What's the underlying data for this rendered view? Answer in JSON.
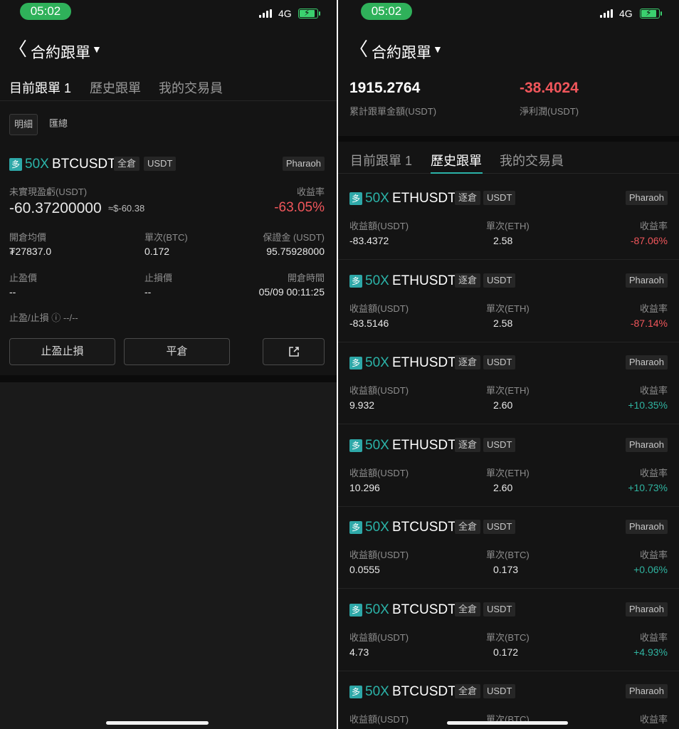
{
  "status": {
    "time": "05:02",
    "network": "4G"
  },
  "header": {
    "title": "合約跟單",
    "back": "〈",
    "caret": "▼"
  },
  "tabs": [
    "目前跟單 1",
    "歷史跟單",
    "我的交易員"
  ],
  "filters": [
    "明細",
    "匯總"
  ],
  "position": {
    "logo": "多",
    "leverage": "50X",
    "symbol": "BTCUSDT",
    "mode": "全倉",
    "quote": "USDT",
    "trader": "Pharaoh",
    "pnl_label": "未實現盈虧(USDT)",
    "pnl_value": "-60.37200000",
    "pnl_approx": "≈$-60.38",
    "roe_label": "收益率",
    "roe_value": "-63.05%",
    "entry_label": "開倉均價",
    "entry_value": "₮27837.0",
    "size_label": "單次(BTC)",
    "size_value": "0.172",
    "margin_label": "保證金 (USDT)",
    "margin_value": "95.75928000",
    "tp_label": "止盈價",
    "tp_value": "--",
    "sl_label": "止損價",
    "sl_value": "--",
    "time_label": "開倉時間",
    "time_value": "05/09 00:11:25",
    "tpsl_label": "止盈/止損 ⓘ --/--",
    "btn_tpsl": "止盈止損",
    "btn_close": "平倉",
    "btn_share_icon": "share-icon"
  },
  "summary": {
    "total_value": "1915.2764",
    "total_label": "累計跟單金額(USDT)",
    "net_value": "-38.4024",
    "net_label": "淨利潤(USDT)"
  },
  "history": [
    {
      "leverage": "50X",
      "symbol": "ETHUSDT",
      "mode": "逐倉",
      "quote": "USDT",
      "trader": "Pharaoh",
      "pnl_label": "收益額(USDT)",
      "pnl": "-83.4372",
      "size_label": "單次(ETH)",
      "size": "2.58",
      "roe_label": "收益率",
      "roe": "-87.06%",
      "roe_color": "#f0565b"
    },
    {
      "leverage": "50X",
      "symbol": "ETHUSDT",
      "mode": "逐倉",
      "quote": "USDT",
      "trader": "Pharaoh",
      "pnl_label": "收益額(USDT)",
      "pnl": "-83.5146",
      "size_label": "單次(ETH)",
      "size": "2.58",
      "roe_label": "收益率",
      "roe": "-87.14%",
      "roe_color": "#f0565b"
    },
    {
      "leverage": "50X",
      "symbol": "ETHUSDT",
      "mode": "逐倉",
      "quote": "USDT",
      "trader": "Pharaoh",
      "pnl_label": "收益額(USDT)",
      "pnl": "9.932",
      "size_label": "單次(ETH)",
      "size": "2.60",
      "roe_label": "收益率",
      "roe": "+10.35%",
      "roe_color": "#2fb3a0"
    },
    {
      "leverage": "50X",
      "symbol": "ETHUSDT",
      "mode": "逐倉",
      "quote": "USDT",
      "trader": "Pharaoh",
      "pnl_label": "收益額(USDT)",
      "pnl": "10.296",
      "size_label": "單次(ETH)",
      "size": "2.60",
      "roe_label": "收益率",
      "roe": "+10.73%",
      "roe_color": "#2fb3a0"
    },
    {
      "leverage": "50X",
      "symbol": "BTCUSDT",
      "mode": "全倉",
      "quote": "USDT",
      "trader": "Pharaoh",
      "pnl_label": "收益額(USDT)",
      "pnl": "0.0555",
      "size_label": "單次(BTC)",
      "size": "0.173",
      "roe_label": "收益率",
      "roe": "+0.06%",
      "roe_color": "#2fb3a0"
    },
    {
      "leverage": "50X",
      "symbol": "BTCUSDT",
      "mode": "全倉",
      "quote": "USDT",
      "trader": "Pharaoh",
      "pnl_label": "收益額(USDT)",
      "pnl": "4.73",
      "size_label": "單次(BTC)",
      "size": "0.172",
      "roe_label": "收益率",
      "roe": "+4.93%",
      "roe_color": "#2fb3a0"
    },
    {
      "leverage": "50X",
      "symbol": "BTCUSDT",
      "mode": "全倉",
      "quote": "USDT",
      "trader": "Pharaoh",
      "pnl_label": "收益額(USDT)",
      "pnl": "",
      "size_label": "單次(BTC)",
      "size": "",
      "roe_label": "收益率",
      "roe": "",
      "roe_color": "#2fb3a0"
    }
  ],
  "colors": {
    "accent": "#2bb3a8",
    "up": "#2fb3a0",
    "down": "#f0565b",
    "time_pill": "#2fb15a",
    "background": "#141414"
  }
}
